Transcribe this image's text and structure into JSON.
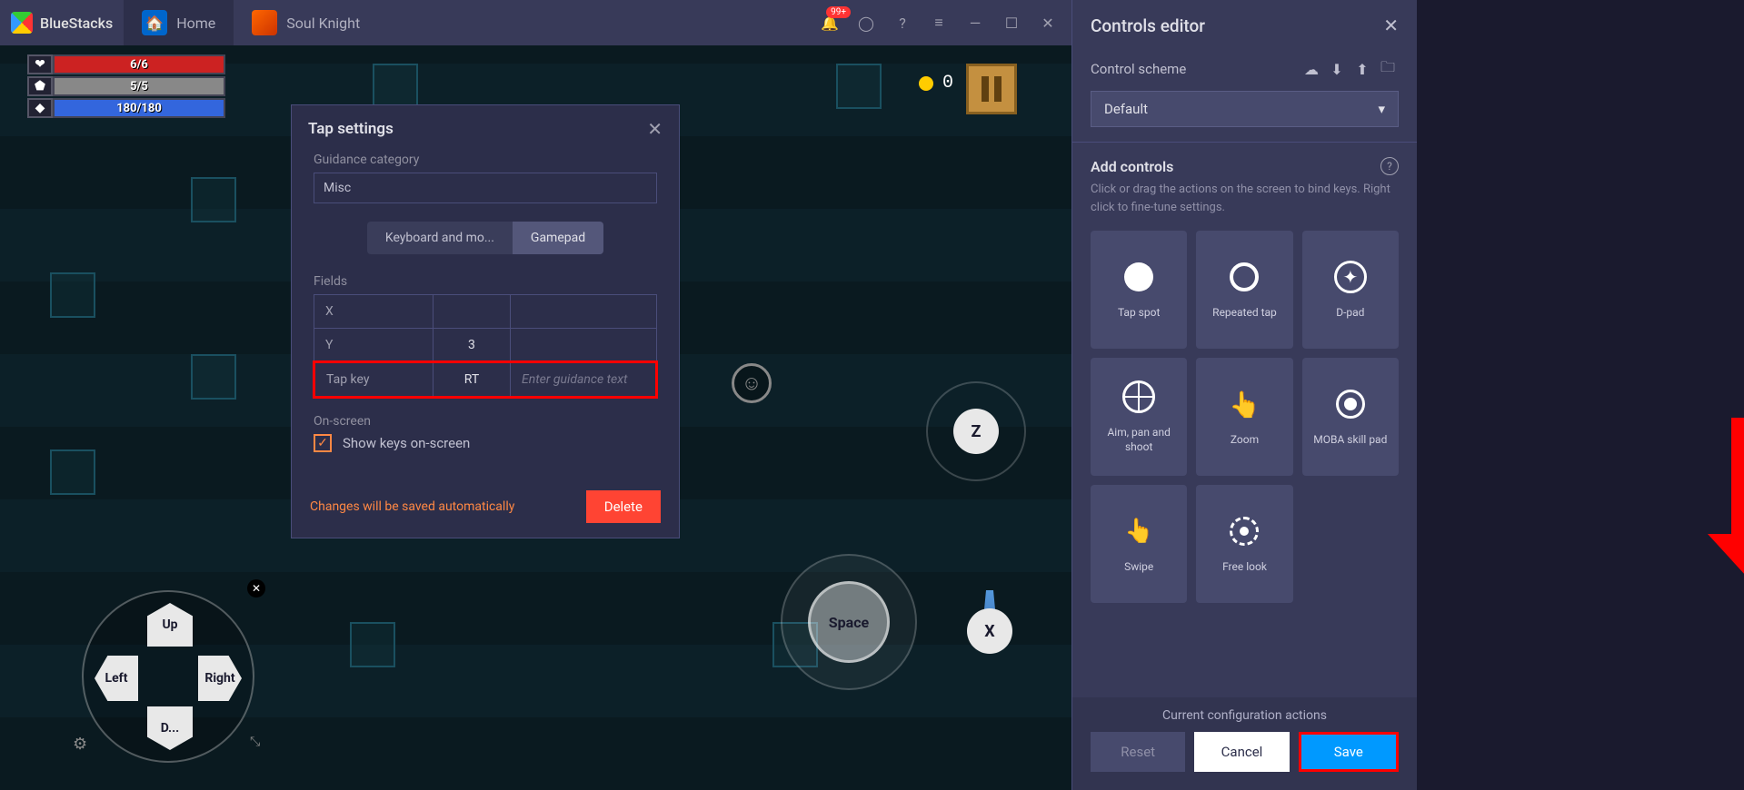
{
  "app": {
    "name": "BlueStacks"
  },
  "tabs": {
    "home": "Home",
    "game": "Soul Knight"
  },
  "notification_badge": "99+",
  "hud": {
    "hp": "6/6",
    "armor": "5/5",
    "mp": "180/180"
  },
  "coins": "0",
  "dpad": {
    "up": "Up",
    "down": "D...",
    "left": "Left",
    "right": "Right"
  },
  "buttons": {
    "z": "Z",
    "x": "X",
    "space": "Space"
  },
  "dialog": {
    "title": "Tap settings",
    "cat_label": "Guidance category",
    "cat_value": "Misc",
    "toggle_kb": "Keyboard and mo...",
    "toggle_gp": "Gamepad",
    "fields_label": "Fields",
    "rows": {
      "x": {
        "name": "X",
        "value": ""
      },
      "y": {
        "name": "Y",
        "value": "3"
      },
      "tap": {
        "name": "Tap key",
        "value": "RT",
        "guide": "Enter guidance text"
      }
    },
    "onscreen_label": "On-screen",
    "show_keys": "Show keys on-screen",
    "autosave": "Changes will be saved automatically",
    "delete": "Delete"
  },
  "panel": {
    "title": "Controls editor",
    "scheme_label": "Control scheme",
    "scheme_value": "Default",
    "add_title": "Add controls",
    "add_desc": "Click or drag the actions on the screen to bind keys. Right click to fine-tune settings.",
    "tiles": {
      "tap": "Tap spot",
      "repeated": "Repeated tap",
      "dpad": "D-pad",
      "aim": "Aim, pan and shoot",
      "zoom": "Zoom",
      "moba": "MOBA skill pad",
      "swipe": "Swipe",
      "freelook": "Free look"
    },
    "footer_label": "Current configuration actions",
    "reset": "Reset",
    "cancel": "Cancel",
    "save": "Save"
  }
}
